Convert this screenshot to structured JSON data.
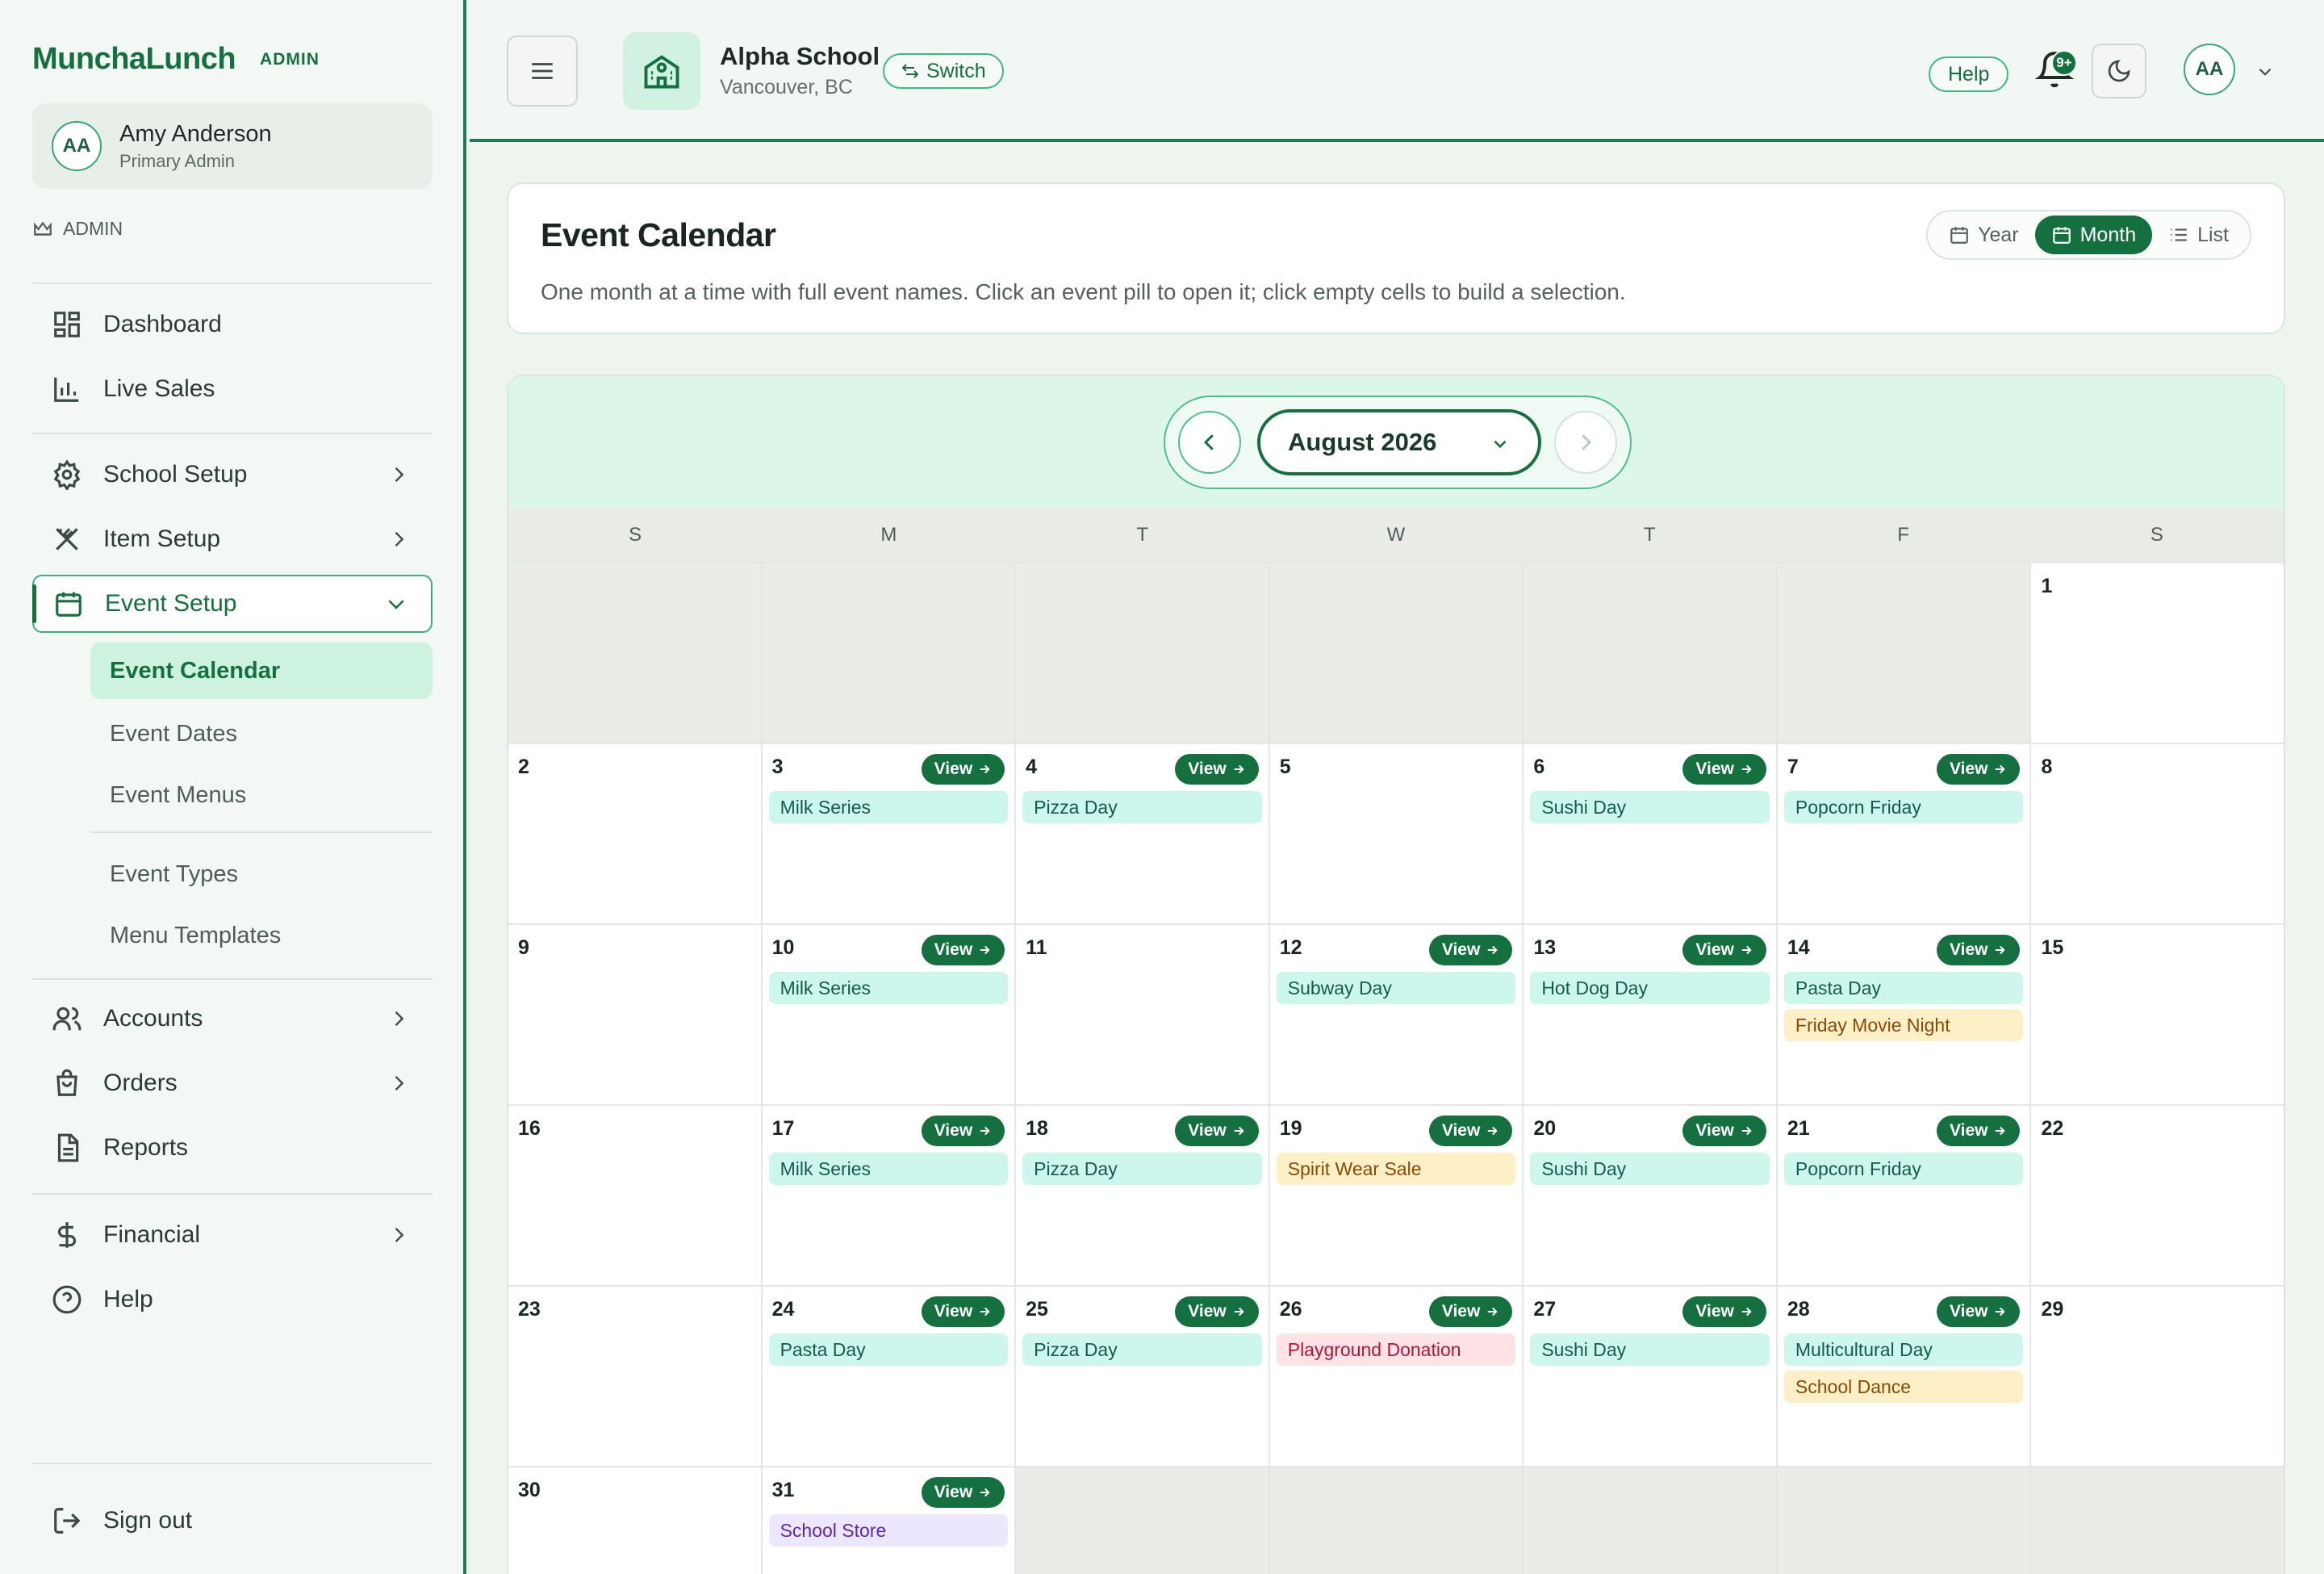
{
  "brand": {
    "name": "MunchaLunch",
    "badge": "ADMIN"
  },
  "user": {
    "initials": "AA",
    "name": "Amy Anderson",
    "role": "Primary Admin"
  },
  "admin_label": "ADMIN",
  "nav": {
    "dashboard": "Dashboard",
    "live_sales": "Live Sales",
    "school_setup": "School Setup",
    "item_setup": "Item Setup",
    "event_setup": "Event Setup",
    "event_calendar": "Event Calendar",
    "event_dates": "Event Dates",
    "event_menus": "Event Menus",
    "event_types": "Event Types",
    "menu_templates": "Menu Templates",
    "accounts": "Accounts",
    "orders": "Orders",
    "reports": "Reports",
    "financial": "Financial",
    "help": "Help",
    "sign_out": "Sign out"
  },
  "topbar": {
    "school_name": "Alpha School",
    "school_location": "Vancouver, BC",
    "switch_label": "Switch",
    "help_label": "Help",
    "notification_badge": "9+",
    "avatar_initials": "AA"
  },
  "header": {
    "title": "Event Calendar",
    "description": "One month at a time with full event names. Click an event pill to open it; click empty cells to build a selection.",
    "views": {
      "year": "Year",
      "month": "Month",
      "list": "List"
    },
    "active_view": "Month"
  },
  "calendar": {
    "month_label": "August 2026",
    "view_label": "View",
    "weekdays": [
      "S",
      "M",
      "T",
      "W",
      "T",
      "F",
      "S"
    ],
    "weeks": [
      [
        {
          "d": ""
        },
        {
          "d": ""
        },
        {
          "d": ""
        },
        {
          "d": ""
        },
        {
          "d": ""
        },
        {
          "d": ""
        },
        {
          "d": "1"
        }
      ],
      [
        {
          "d": "2"
        },
        {
          "d": "3",
          "v": true,
          "e": [
            {
              "n": "Milk Series",
              "c": "teal"
            }
          ]
        },
        {
          "d": "4",
          "v": true,
          "e": [
            {
              "n": "Pizza Day",
              "c": "teal"
            }
          ]
        },
        {
          "d": "5"
        },
        {
          "d": "6",
          "v": true,
          "e": [
            {
              "n": "Sushi Day",
              "c": "teal"
            }
          ]
        },
        {
          "d": "7",
          "v": true,
          "e": [
            {
              "n": "Popcorn Friday",
              "c": "teal"
            }
          ]
        },
        {
          "d": "8"
        }
      ],
      [
        {
          "d": "9"
        },
        {
          "d": "10",
          "v": true,
          "e": [
            {
              "n": "Milk Series",
              "c": "teal"
            }
          ]
        },
        {
          "d": "11"
        },
        {
          "d": "12",
          "v": true,
          "e": [
            {
              "n": "Subway Day",
              "c": "teal"
            }
          ]
        },
        {
          "d": "13",
          "v": true,
          "e": [
            {
              "n": "Hot Dog Day",
              "c": "teal"
            }
          ]
        },
        {
          "d": "14",
          "v": true,
          "e": [
            {
              "n": "Pasta Day",
              "c": "teal"
            },
            {
              "n": "Friday Movie Night",
              "c": "yellow"
            }
          ]
        },
        {
          "d": "15"
        }
      ],
      [
        {
          "d": "16"
        },
        {
          "d": "17",
          "v": true,
          "e": [
            {
              "n": "Milk Series",
              "c": "teal"
            }
          ]
        },
        {
          "d": "18",
          "v": true,
          "e": [
            {
              "n": "Pizza Day",
              "c": "teal"
            }
          ]
        },
        {
          "d": "19",
          "v": true,
          "e": [
            {
              "n": "Spirit Wear Sale",
              "c": "yellow"
            }
          ]
        },
        {
          "d": "20",
          "v": true,
          "e": [
            {
              "n": "Sushi Day",
              "c": "teal"
            }
          ]
        },
        {
          "d": "21",
          "v": true,
          "e": [
            {
              "n": "Popcorn Friday",
              "c": "teal"
            }
          ]
        },
        {
          "d": "22"
        }
      ],
      [
        {
          "d": "23"
        },
        {
          "d": "24",
          "v": true,
          "e": [
            {
              "n": "Pasta Day",
              "c": "teal"
            }
          ]
        },
        {
          "d": "25",
          "v": true,
          "e": [
            {
              "n": "Pizza Day",
              "c": "teal"
            }
          ]
        },
        {
          "d": "26",
          "v": true,
          "e": [
            {
              "n": "Playground Donation",
              "c": "pink"
            }
          ]
        },
        {
          "d": "27",
          "v": true,
          "e": [
            {
              "n": "Sushi Day",
              "c": "teal"
            }
          ]
        },
        {
          "d": "28",
          "v": true,
          "e": [
            {
              "n": "Multicultural Day",
              "c": "teal"
            },
            {
              "n": "School Dance",
              "c": "yellow"
            }
          ]
        },
        {
          "d": "29"
        }
      ],
      [
        {
          "d": "30"
        },
        {
          "d": "31",
          "v": true,
          "e": [
            {
              "n": "School Store",
              "c": "purple"
            }
          ]
        },
        {
          "d": ""
        },
        {
          "d": ""
        },
        {
          "d": ""
        },
        {
          "d": ""
        },
        {
          "d": ""
        }
      ]
    ]
  },
  "colors": {
    "primary": "#14713f",
    "accent": "#38b07e",
    "event_teal": "#cdf7ed",
    "event_yellow": "#fdf0c6",
    "event_pink": "#fde3e6",
    "event_purple": "#ece7fd"
  }
}
